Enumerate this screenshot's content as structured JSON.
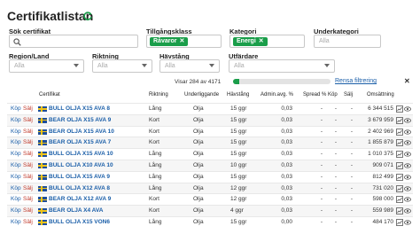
{
  "header": {
    "title": "Certifikatlistan"
  },
  "filters": {
    "search": {
      "label": "Sök certifikat",
      "value": ""
    },
    "tillgangsklass": {
      "label": "Tillgångsklass",
      "chip": "Råvaror"
    },
    "kategori": {
      "label": "Kategori",
      "chip": "Energi"
    },
    "underkategori": {
      "label": "Underkategori",
      "placeholder": "Alla"
    },
    "region": {
      "label": "Region/Land",
      "placeholder": "Alla"
    },
    "riktning": {
      "label": "Riktning",
      "placeholder": "Alla"
    },
    "havstang": {
      "label": "Hävstång",
      "placeholder": "Alla"
    },
    "utfardare": {
      "label": "Utfärdare",
      "placeholder": "Alla"
    },
    "chip_remove_glyph": "✕"
  },
  "results": {
    "summary": "Visar 284 av 4171",
    "progress_fraction": 0.068,
    "clear_filters": "Rensa filtrering",
    "clear_glyph": "✕"
  },
  "table": {
    "columns": {
      "certifikat": "Certifikat",
      "riktning": "Riktning",
      "underliggande": "Underliggande",
      "havstang": "Hävstång",
      "admin": "Admin.avg. %",
      "spread": "Spread %",
      "kop": "Köp",
      "salj": "Sälj",
      "omsattning": "Omsättning"
    },
    "actions": {
      "kop": "Köp",
      "salj": "Sälj"
    },
    "rows": [
      {
        "name": "BULL OLJA X15 AVA 8",
        "riktning": "Lång",
        "underliggande": "Olja",
        "havstang": "15 ggr",
        "admin": "0,03",
        "spread": "-",
        "kop": "-",
        "salj": "-",
        "oms": "6 344 515"
      },
      {
        "name": "BEAR OLJA X15 AVA 9",
        "riktning": "Kort",
        "underliggande": "Olja",
        "havstang": "15 ggr",
        "admin": "0,03",
        "spread": "-",
        "kop": "-",
        "salj": "-",
        "oms": "3 679 959"
      },
      {
        "name": "BEAR OLJA X15 AVA 10",
        "riktning": "Kort",
        "underliggande": "Olja",
        "havstang": "15 ggr",
        "admin": "0,03",
        "spread": "-",
        "kop": "-",
        "salj": "-",
        "oms": "2 402 969"
      },
      {
        "name": "BEAR OLJA X15 AVA 7",
        "riktning": "Kort",
        "underliggande": "Olja",
        "havstang": "15 ggr",
        "admin": "0,03",
        "spread": "-",
        "kop": "-",
        "salj": "-",
        "oms": "1 855 879"
      },
      {
        "name": "BULL OLJA X15 AVA 10",
        "riktning": "Lång",
        "underliggande": "Olja",
        "havstang": "15 ggr",
        "admin": "0,03",
        "spread": "-",
        "kop": "-",
        "salj": "-",
        "oms": "1 010 375"
      },
      {
        "name": "BULL OLJA X10 AVA 10",
        "riktning": "Lång",
        "underliggande": "Olja",
        "havstang": "10 ggr",
        "admin": "0,03",
        "spread": "-",
        "kop": "-",
        "salj": "-",
        "oms": "909 071"
      },
      {
        "name": "BULL OLJA X15 AVA 9",
        "riktning": "Lång",
        "underliggande": "Olja",
        "havstang": "15 ggr",
        "admin": "0,03",
        "spread": "-",
        "kop": "-",
        "salj": "-",
        "oms": "812 499"
      },
      {
        "name": "BULL OLJA X12 AVA 8",
        "riktning": "Lång",
        "underliggande": "Olja",
        "havstang": "12 ggr",
        "admin": "0,03",
        "spread": "-",
        "kop": "-",
        "salj": "-",
        "oms": "731 020"
      },
      {
        "name": "BEAR OLJA X12 AVA 9",
        "riktning": "Kort",
        "underliggande": "Olja",
        "havstang": "12 ggr",
        "admin": "0,03",
        "spread": "-",
        "kop": "-",
        "salj": "-",
        "oms": "598 000"
      },
      {
        "name": "BEAR OLJA X4 AVA",
        "riktning": "Kort",
        "underliggande": "Olja",
        "havstang": "4 ggr",
        "admin": "0,03",
        "spread": "-",
        "kop": "-",
        "salj": "-",
        "oms": "559 989"
      },
      {
        "name": "BULL OLJA X15 VON6",
        "riktning": "Lång",
        "underliggande": "Olja",
        "havstang": "15 ggr",
        "admin": "0,00",
        "spread": "-",
        "kop": "-",
        "salj": "-",
        "oms": "484 170"
      }
    ]
  },
  "icons": {
    "refresh": "refresh-icon",
    "search": "search-icon",
    "chart": "chart-icon",
    "view": "eye-icon",
    "flag": "sweden-flag-icon"
  },
  "colors": {
    "accent": "#1a9e4a",
    "link": "#1a5ea8",
    "sell": "#c0392b"
  }
}
